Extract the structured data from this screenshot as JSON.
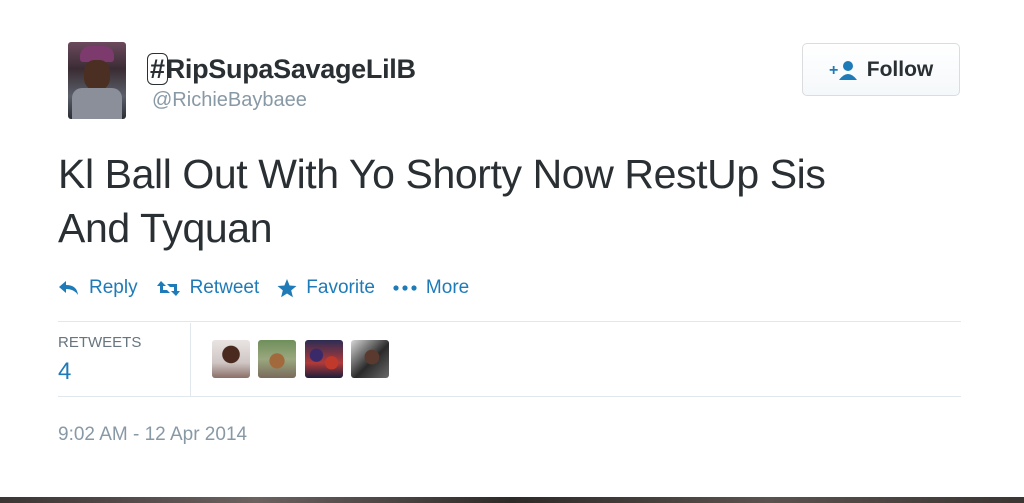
{
  "user": {
    "display_name_hash": "#",
    "display_name_rest": "RipSupaSavageLilB",
    "screen_name": "@RichieBaybaee",
    "avatar_icon": "profile-photo"
  },
  "follow_button": {
    "label": "Follow",
    "icon": "add-user-icon"
  },
  "tweet": {
    "line1": "Kl Ball Out With Yo Shorty Now RestUp Sis",
    "line2": "And Tyquan"
  },
  "actions": [
    {
      "label": "Reply",
      "icon": "reply-icon"
    },
    {
      "label": "Retweet",
      "icon": "retweet-icon"
    },
    {
      "label": "Favorite",
      "icon": "star-icon"
    },
    {
      "label": "More",
      "icon": "more-dots-icon"
    }
  ],
  "stats": {
    "label": "RETWEETS",
    "count": "4"
  },
  "timestamp": "9:02 AM - 12 Apr 2014",
  "colors": {
    "link": "#1e7bb8",
    "text": "#292f33",
    "muted": "#8899a6",
    "border": "#e1e8ed"
  }
}
